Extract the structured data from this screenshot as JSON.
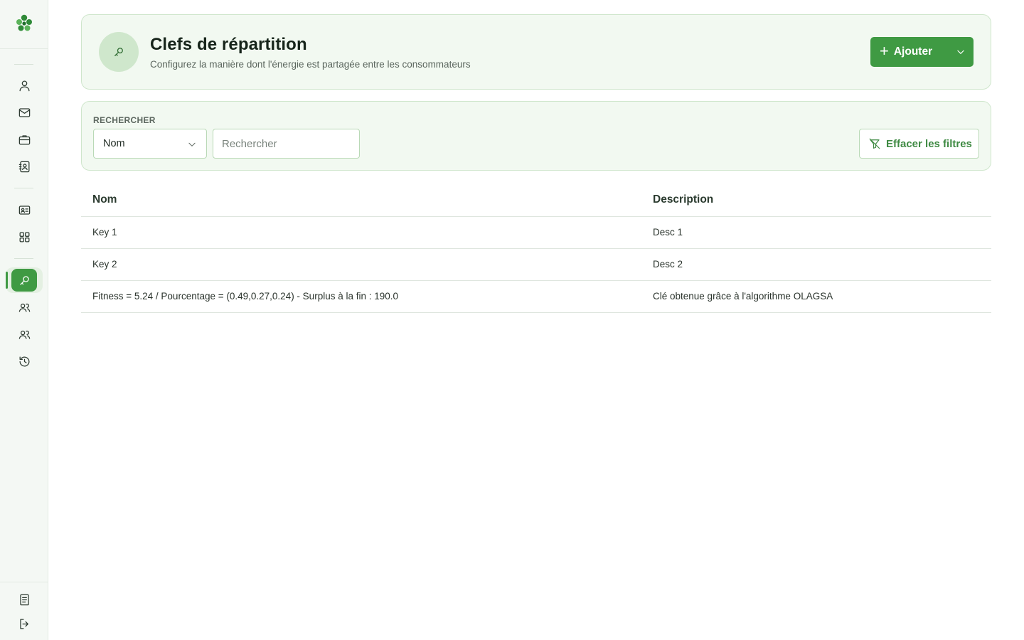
{
  "header": {
    "title": "Clefs de répartition",
    "subtitle": "Configurez la manière dont l'énergie est partagée entre les consommateurs",
    "add_label": "Ajouter",
    "icon": "key-icon"
  },
  "filters": {
    "section_label": "RECHERCHER",
    "field_select_value": "Nom",
    "search_placeholder": "Rechercher",
    "search_value": "",
    "clear_label": "Effacer les filtres"
  },
  "table": {
    "columns": [
      "Nom",
      "Description"
    ],
    "rows": [
      {
        "name": "Key 1",
        "description": "Desc 1"
      },
      {
        "name": "Key 2",
        "description": "Desc 2"
      },
      {
        "name": "Fitness = 5.24 / Pourcentage = (0.49,0.27,0.24) - Surplus à la fin : 190.0",
        "description": "Clé obtenue grâce à l'algorithme OLAGSA"
      }
    ]
  },
  "sidebar": {
    "items": [
      {
        "icon": "user-icon"
      },
      {
        "icon": "mail-icon"
      },
      {
        "icon": "briefcase-icon"
      },
      {
        "icon": "contact-book-icon"
      },
      {
        "icon": "id-card-icon"
      },
      {
        "icon": "grid-icon"
      },
      {
        "icon": "key-icon",
        "active": true
      },
      {
        "icon": "users-icon"
      },
      {
        "icon": "users-icon"
      },
      {
        "icon": "history-icon"
      },
      {
        "icon": "document-icon"
      },
      {
        "icon": "logout-icon"
      }
    ]
  },
  "colors": {
    "primary": "#3f9a43",
    "card_bg": "#f2f9f1",
    "card_border": "#cfe6cc",
    "sidebar_bg": "#f4f8f4"
  }
}
